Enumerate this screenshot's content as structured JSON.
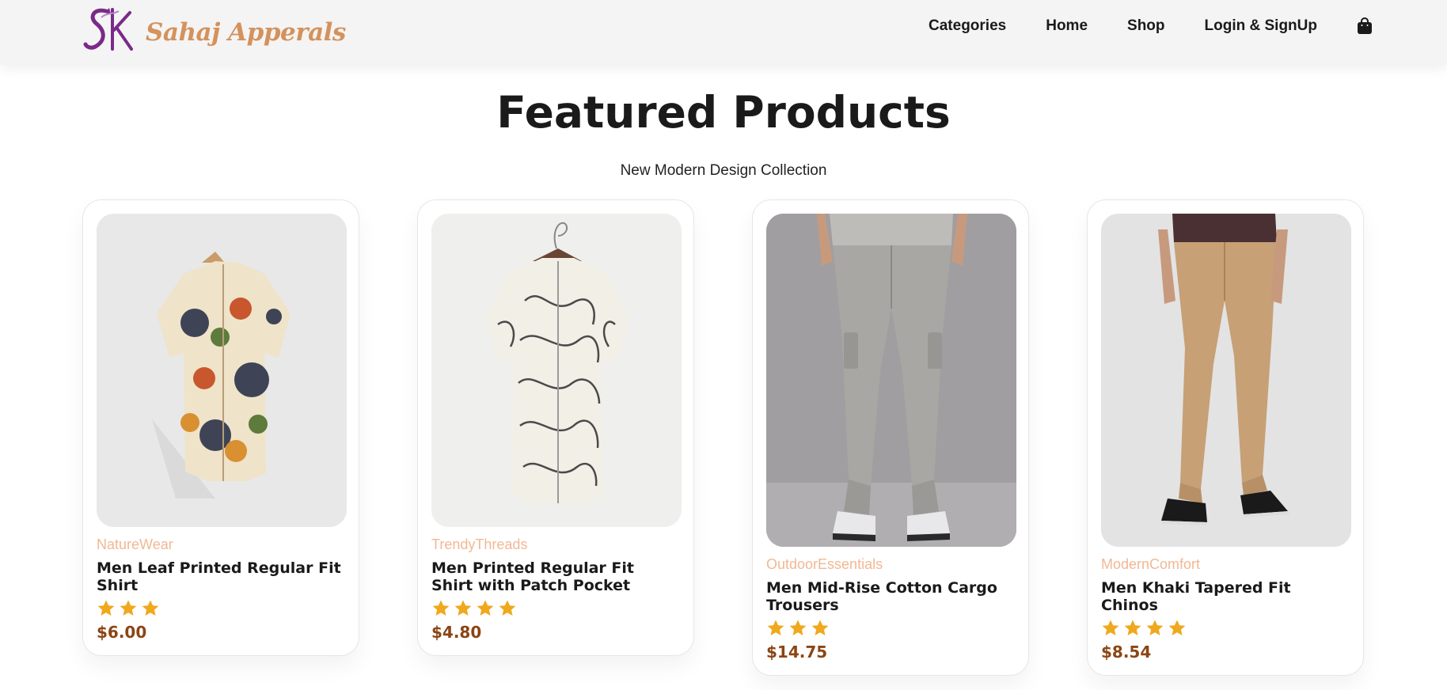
{
  "header": {
    "brand": "Sahaj Apperals",
    "nav": [
      "Categories",
      "Home",
      "Shop",
      "Login & SignUp"
    ],
    "cart_icon": "shopping-bag-icon"
  },
  "main": {
    "title": "Featured Products",
    "subtitle": "New Modern Design Collection"
  },
  "products": [
    {
      "brand": "NatureWear",
      "name": "Men Leaf Printed Regular Fit Shirt",
      "rating": 3,
      "price": "$6.00"
    },
    {
      "brand": "TrendyThreads",
      "name": "Men Printed Regular Fit Shirt with Patch Pocket",
      "rating": 4,
      "price": "$4.80"
    },
    {
      "brand": "OutdoorEssentials",
      "name": "Men Mid-Rise Cotton Cargo Trousers",
      "rating": 3,
      "price": "$14.75"
    },
    {
      "brand": "ModernComfort",
      "name": "Men Khaki Tapered Fit Chinos",
      "rating": 4,
      "price": "$8.54"
    }
  ],
  "colors": {
    "brand": "#d4925c",
    "brand_label": "#f1b894",
    "price": "#8b4513",
    "star": "#f0a81c",
    "logo": "#7a2a8a"
  }
}
